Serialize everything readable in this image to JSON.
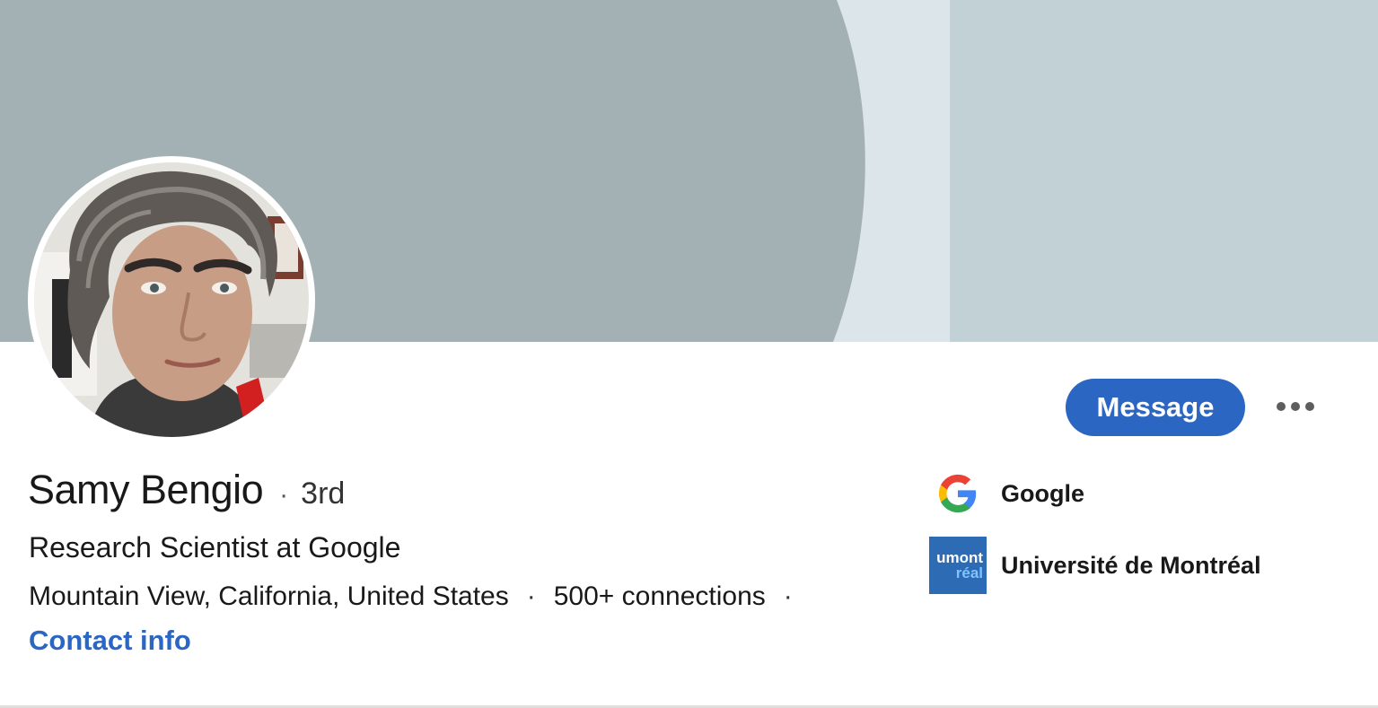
{
  "profile": {
    "name": "Samy Bengio",
    "separator": "·",
    "degree": "3rd",
    "headline": "Research Scientist at Google",
    "location": "Mountain View, California, United States",
    "connections": "500+ connections",
    "contact_link": "Contact info"
  },
  "actions": {
    "message_label": "Message",
    "more_icon": "ellipsis-icon"
  },
  "organizations": [
    {
      "name": "Google",
      "logo": "google-logo"
    },
    {
      "name": "Université de Montréal",
      "logo": "udem-logo",
      "logo_text_top": "umont",
      "logo_text_bottom": "réal"
    }
  ],
  "colors": {
    "accent": "#2a66c2",
    "banner_dark": "#a3b1b4",
    "banner_light": "#dce5e9",
    "banner_right": "#c2d1d6"
  }
}
